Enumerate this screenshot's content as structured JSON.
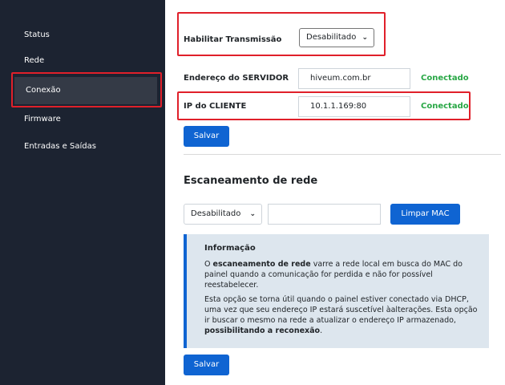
{
  "sidebar": {
    "items": [
      "Status",
      "Rede",
      "Conexão",
      "Firmware",
      "Entradas e Saídas"
    ]
  },
  "transmission": {
    "label": "Habilitar Transmissão",
    "select_value": "Desabilitado"
  },
  "server": {
    "label": "Endereço do SERVIDOR",
    "value": "hiveum.com.br",
    "status": "Conectado"
  },
  "client": {
    "label": "IP do CLIENTE",
    "value": "10.1.1.169:80",
    "status": "Conectado"
  },
  "save_label": "Salvar",
  "scan": {
    "title": "Escaneamento de rede",
    "select_value": "Desabilitado",
    "mac_value": "",
    "clear_button": "Limpar MAC"
  },
  "info": {
    "title": "Informação",
    "p1_pre": "O ",
    "p1_bold": "escaneamento de rede",
    "p1_post": " varre a rede local em busca do MAC do painel quando a comunicação for perdida e não for possível reestabelecer.",
    "p2_pre": "Esta opção se torna útil quando o painel estiver conectado via DHCP, uma vez que seu endereço IP estará suscetível àalterações. Esta opção ir buscar o mesmo na rede a atualizar o endereço IP armazenado, ",
    "p2_bold": "possibilitando a reconexão",
    "p2_post": "."
  },
  "colors": {
    "sidebar_bg": "#1c2331",
    "active_bg": "#343a46",
    "primary": "#0f64d2",
    "success": "#28a745",
    "highlight": "#e0202a",
    "info_bg": "#dde6ee"
  }
}
